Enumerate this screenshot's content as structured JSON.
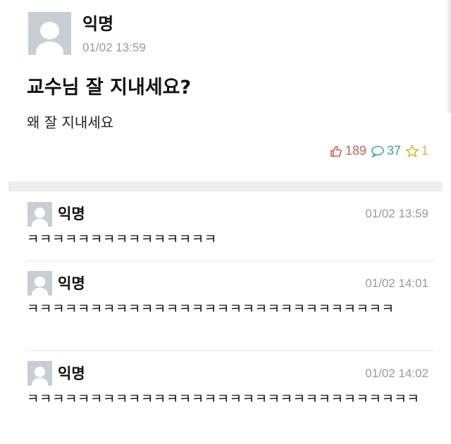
{
  "post": {
    "author": "익명",
    "time": "01/02 13:59",
    "title": "교수님 잘 지내세요?",
    "body": "왜 잘 지내세요",
    "likes": "189",
    "comments": "37",
    "scraps": "1"
  },
  "comments": [
    {
      "author": "익명",
      "time": "01/02 13:59",
      "text": "ㅋㅋㅋㅋㅋㅋㅋㅋㅋㅋㅋㅋㅋㅋㅋ"
    },
    {
      "author": "익명",
      "time": "01/02 14:01",
      "text": "ㅋㅋㅋㅋㅋㅋㅋㅋㅋㅋㅋㅋㅋㅋㅋㅋㅋㅋㅋㅋㅋㅋㅋㅋㅋㅋㅋㅋㅋ"
    },
    {
      "author": "익명",
      "time": "01/02 14:02",
      "text": "ㅋㅋㅋㅋㅋㅋㅋㅋㅋㅋㅋㅋㅋㅋㅋㅋㅋㅋㅋㅋㅋㅋㅋㅋㅋㅋㅋㅋㅋㅋㅋ"
    }
  ],
  "icons": {
    "like": "thumbs-up-icon",
    "comment": "speech-bubble-icon",
    "scrap": "star-icon",
    "avatar": "default-avatar-icon"
  },
  "colors": {
    "like": "#e05a4e",
    "comment": "#3aa6b0",
    "scrap": "#d8b82a",
    "avatar_bg": "#c9ced3",
    "meta_text": "#9a9a9a"
  }
}
